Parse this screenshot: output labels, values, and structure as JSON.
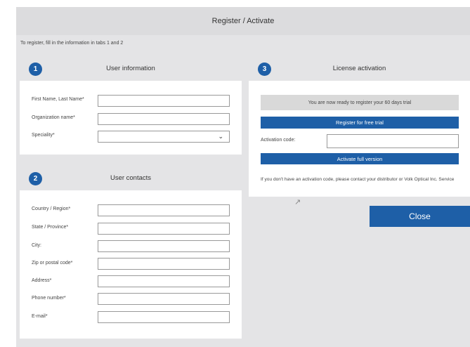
{
  "dialog": {
    "title": "Register / Activate",
    "instructions": "To register, fill in the information in tabs 1 and 2"
  },
  "user_information": {
    "number": "1",
    "title": "User information",
    "fields": {
      "name_label": "First Name, Last Name*",
      "organization_label": "Organization name*",
      "speciality_label": "Speciality*"
    }
  },
  "user_contacts": {
    "number": "2",
    "title": "User contacts",
    "fields": {
      "country_label": "Country / Region*",
      "state_label": "State / Province*",
      "city_label": "City:",
      "zip_label": "Zip or postal code*",
      "address_label": "Address*",
      "phone_label": "Phone number*",
      "email_label": "E-mail*"
    }
  },
  "license_activation": {
    "number": "3",
    "title": "License activation",
    "status": "You are now ready to register your 60 days trial",
    "register_trial_label": "Register for free trial",
    "activation_code_label": "Activation code:",
    "activate_label": "Activate full version",
    "note": "If you don't have an activation code, please contact your distributor or Volk Optical Inc. Service"
  },
  "close_label": "Close",
  "colors": {
    "accent": "#1e5fa7",
    "panel_bg": "#ffffff",
    "dialog_bg": "#e4e4e6"
  },
  "icons": {
    "dropdown": "chevron-down-icon",
    "cursor": "mouse-cursor-icon"
  }
}
